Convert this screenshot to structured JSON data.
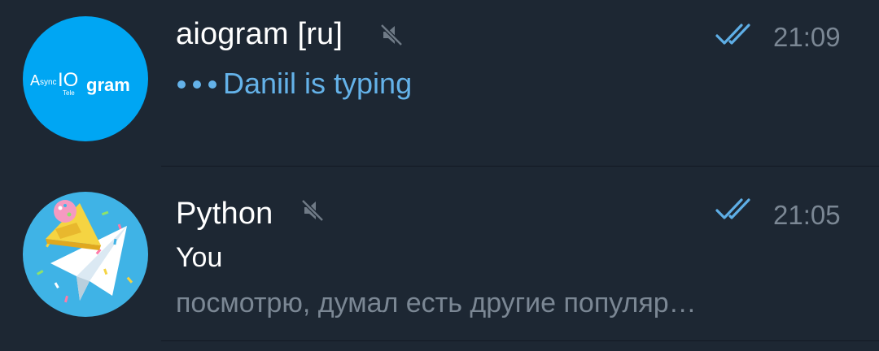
{
  "colors": {
    "background": "#1d2733",
    "divider": "#121a23",
    "title_text": "#ffffff",
    "time_text": "#7b8794",
    "preview_text": "#7b8794",
    "typing_text": "#64b2e9",
    "read_check": "#5eaee6",
    "mute_icon": "#6f7a86",
    "aiogram_avatar_bg": "#00a6f3",
    "python_avatar_bg": "#3fb3e6"
  },
  "chats": [
    {
      "title": "aiogram [ru]",
      "muted": true,
      "read_status": "double-check-icon",
      "time": "21:09",
      "typing_text": "Daniil is typing",
      "avatar": {
        "icon": "asyncio-telegram-logo",
        "logo_text_a": "A",
        "logo_text_sync": "sync",
        "logo_text_io": "IO",
        "logo_text_tele": "Tele",
        "logo_text_gram": "gram"
      }
    },
    {
      "title": "Python",
      "muted": true,
      "read_status": "double-check-icon",
      "time": "21:05",
      "sender": "You",
      "preview": "посмотрю, думал есть другие популяр…",
      "avatar": {
        "icon": "telegram-plane-party-hat-icon"
      }
    }
  ]
}
